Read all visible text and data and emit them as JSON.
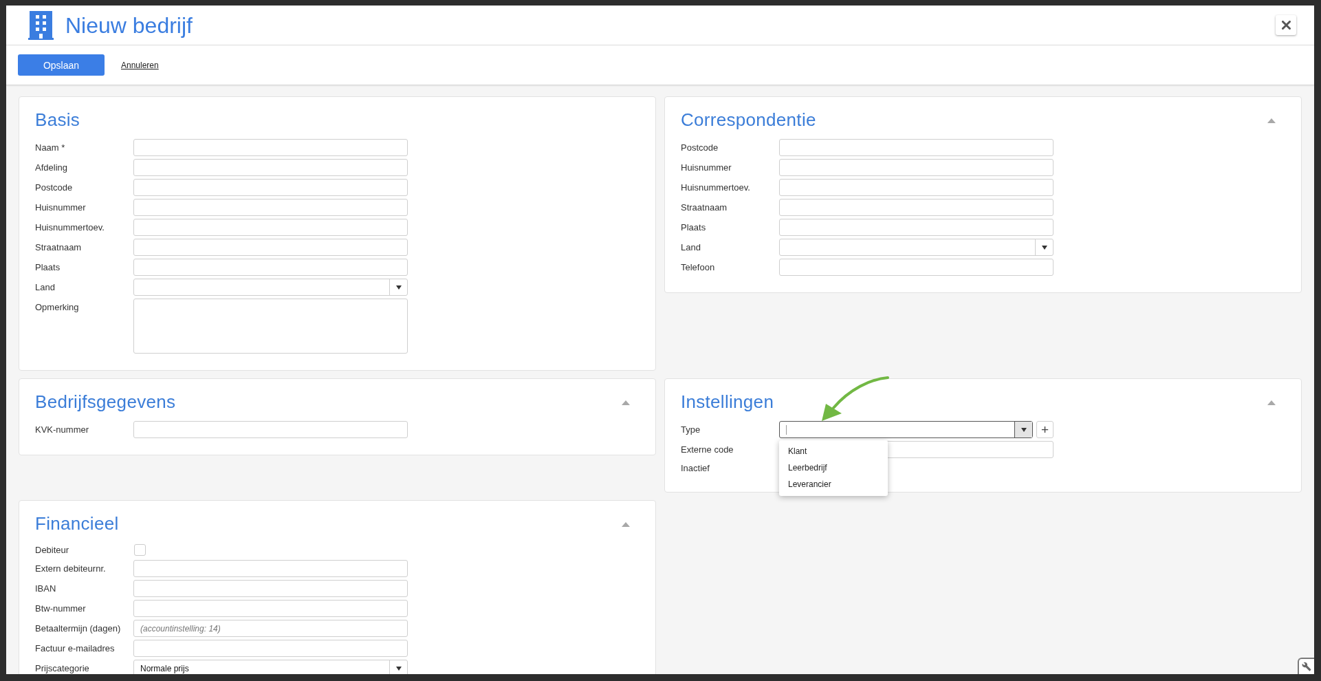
{
  "header": {
    "title": "Nieuw bedrijf"
  },
  "toolbar": {
    "save_button": "Opslaan",
    "cancel_link": "Annuleren"
  },
  "panels": [
    {
      "title": "Basis",
      "collapsible": false,
      "fields": [
        {
          "label": "Naam *",
          "kind": "text"
        },
        {
          "label": "Afdeling",
          "kind": "text"
        },
        {
          "label": "Postcode",
          "kind": "text"
        },
        {
          "label": "Huisnummer",
          "kind": "text"
        },
        {
          "label": "Huisnummertoev.",
          "kind": "text"
        },
        {
          "label": "Straatnaam",
          "kind": "text"
        },
        {
          "label": "Plaats",
          "kind": "text"
        },
        {
          "label": "Land",
          "kind": "select",
          "open": false
        },
        {
          "label": "Opmerking",
          "kind": "textarea"
        }
      ]
    },
    {
      "title": "Correspondentie",
      "collapsible": true,
      "fields": [
        {
          "label": "Postcode",
          "kind": "text"
        },
        {
          "label": "Huisnummer",
          "kind": "text"
        },
        {
          "label": "Huisnummertoev.",
          "kind": "text"
        },
        {
          "label": "Straatnaam",
          "kind": "text"
        },
        {
          "label": "Plaats",
          "kind": "text"
        },
        {
          "label": "Land",
          "kind": "select",
          "open": false
        },
        {
          "label": "Telefoon",
          "kind": "text"
        }
      ]
    },
    {
      "title": "Bedrijfsgegevens",
      "collapsible": true,
      "fields": [
        {
          "label": "KVK-nummer",
          "kind": "text"
        }
      ]
    },
    {
      "title": "Instellingen",
      "collapsible": true,
      "fields": [
        {
          "label": "Type",
          "kind": "select",
          "open": true,
          "add_button": "+",
          "options": [
            "Klant",
            "Leerbedrijf",
            "Leverancier"
          ]
        },
        {
          "label": "Externe code",
          "kind": "text"
        },
        {
          "label": "Inactief",
          "kind": "covered"
        }
      ]
    },
    {
      "title": "Financieel",
      "collapsible": true,
      "fields": [
        {
          "label": "Debiteur",
          "kind": "checkbox",
          "checked": false
        },
        {
          "label": "Extern debiteurnr.",
          "kind": "text"
        },
        {
          "label": "IBAN",
          "kind": "text"
        },
        {
          "label": "Btw-nummer",
          "kind": "text"
        },
        {
          "label": "Betaaltermijn (dagen)",
          "kind": "text",
          "placeholder": "(accountinstelling: 14)"
        },
        {
          "label": "Factuur e-mailadres",
          "kind": "text"
        },
        {
          "label": "Prijscategorie",
          "kind": "select",
          "open": false,
          "value": "Normale prijs"
        }
      ]
    }
  ]
}
